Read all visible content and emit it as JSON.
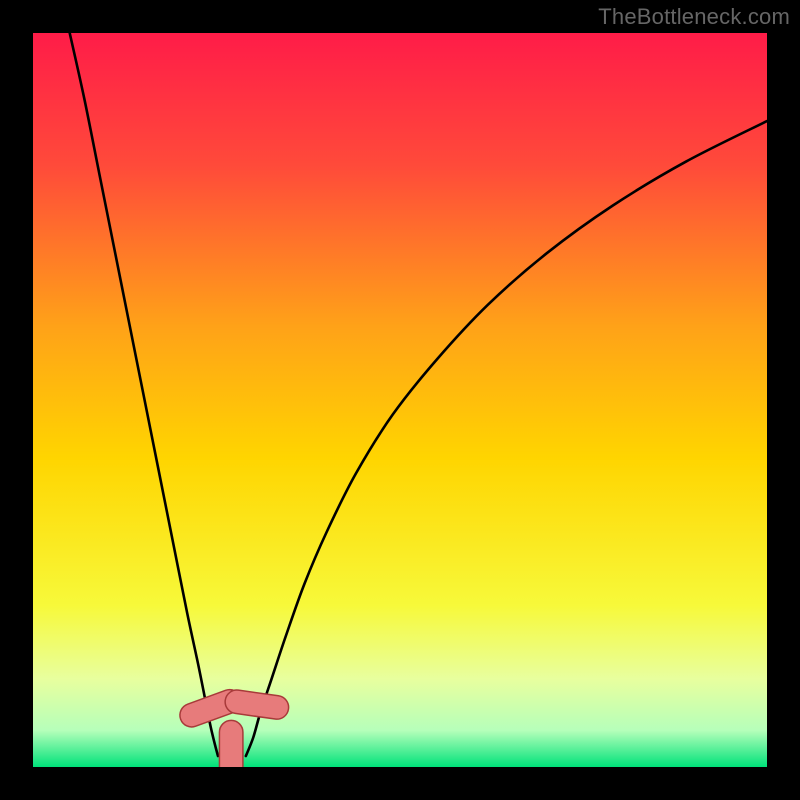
{
  "watermark": "TheBottleneck.com",
  "chart_data": {
    "type": "line",
    "title": "",
    "xlabel": "",
    "ylabel": "",
    "xlim": [
      0,
      100
    ],
    "ylim": [
      0,
      100
    ],
    "grid": false,
    "legend": false,
    "background_gradient": {
      "stops": [
        {
          "offset": 0.0,
          "color": "#ff1c48"
        },
        {
          "offset": 0.18,
          "color": "#ff4a3a"
        },
        {
          "offset": 0.4,
          "color": "#ffa218"
        },
        {
          "offset": 0.58,
          "color": "#ffd500"
        },
        {
          "offset": 0.78,
          "color": "#f7f93a"
        },
        {
          "offset": 0.88,
          "color": "#e8ff9e"
        },
        {
          "offset": 0.95,
          "color": "#b6ffba"
        },
        {
          "offset": 1.0,
          "color": "#00e27a"
        }
      ]
    },
    "series": [
      {
        "name": "left-curve",
        "x": [
          5.0,
          7.0,
          9.0,
          11.0,
          13.0,
          15.0,
          17.0,
          19.0,
          21.0,
          22.5,
          23.5,
          24.2,
          24.8,
          25.2
        ],
        "y": [
          100.0,
          91.0,
          81.0,
          71.0,
          61.0,
          51.0,
          41.0,
          31.0,
          21.0,
          14.0,
          9.0,
          5.5,
          3.0,
          1.5
        ]
      },
      {
        "name": "right-curve",
        "x": [
          29.0,
          30.0,
          31.0,
          32.5,
          34.5,
          37.0,
          40.0,
          44.0,
          49.0,
          55.0,
          62.0,
          70.0,
          79.0,
          89.0,
          100.0
        ],
        "y": [
          1.5,
          4.0,
          7.5,
          12.0,
          18.0,
          25.0,
          32.0,
          40.0,
          48.0,
          55.5,
          63.0,
          70.0,
          76.5,
          82.5,
          88.0
        ]
      }
    ],
    "markers": [
      {
        "name": "left-valley-marker",
        "shape": "capsule",
        "cx": 24.2,
        "cy": 8.0,
        "angle": -20,
        "len": 5.5,
        "radius": 1.6,
        "fill": "#e77b7b",
        "stroke": "#a83a3a"
      },
      {
        "name": "right-valley-marker",
        "shape": "capsule",
        "cx": 30.5,
        "cy": 8.5,
        "angle": 8,
        "len": 5.5,
        "radius": 1.6,
        "fill": "#e77b7b",
        "stroke": "#a83a3a"
      },
      {
        "name": "bottom-marker",
        "shape": "capsule",
        "cx": 27.0,
        "cy": 1.0,
        "angle": 90,
        "len": 7.5,
        "radius": 1.6,
        "fill": "#e77b7b",
        "stroke": "#a83a3a"
      }
    ]
  }
}
